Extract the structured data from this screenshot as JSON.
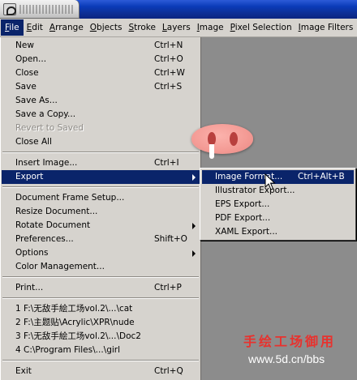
{
  "colors": {
    "menu_bg": "#d6d3ce",
    "highlight": "#0a246a",
    "workspace": "#8c8c8c",
    "titlebar": "#0a3bb8",
    "watermark_red": "#e8322e"
  },
  "menubar": {
    "items": [
      {
        "key": "F",
        "rest": "ile"
      },
      {
        "key": "E",
        "rest": "dit"
      },
      {
        "key": "A",
        "rest": "rrange"
      },
      {
        "key": "O",
        "rest": "bjects"
      },
      {
        "key": "S",
        "rest": "troke"
      },
      {
        "key": "L",
        "rest": "ayers"
      },
      {
        "key": "I",
        "rest": "mage"
      },
      {
        "key": "P",
        "rest": "ixel Selection"
      },
      {
        "key": "I",
        "rest": "mage Filters"
      }
    ]
  },
  "file_menu": {
    "new": {
      "label": "New",
      "shortcut": "Ctrl+N"
    },
    "open": {
      "label": "Open...",
      "shortcut": "Ctrl+O"
    },
    "close": {
      "label": "Close",
      "shortcut": "Ctrl+W"
    },
    "save": {
      "label": "Save",
      "shortcut": "Ctrl+S"
    },
    "save_as": {
      "label": "Save As..."
    },
    "save_copy": {
      "label": "Save a Copy..."
    },
    "revert": {
      "label": "Revert to Saved"
    },
    "close_all": {
      "label": "Close All"
    },
    "insert_image": {
      "label": "Insert Image...",
      "shortcut": "Ctrl+I"
    },
    "export": {
      "label": "Export"
    },
    "frame_setup": {
      "label": "Document Frame Setup..."
    },
    "resize": {
      "label": "Resize Document..."
    },
    "rotate": {
      "label": "Rotate Document"
    },
    "preferences": {
      "label": "Preferences...",
      "shortcut": "Shift+O"
    },
    "options": {
      "label": "Options"
    },
    "color_mgmt": {
      "label": "Color Management..."
    },
    "print": {
      "label": "Print...",
      "shortcut": "Ctrl+P"
    },
    "recent": [
      "1 F:\\无敌手絵工场vol.2\\...\\cat",
      "2 F:\\主题贴\\Acrylic\\XPR\\nude",
      "3 F:\\无敌手絵工场vol.2\\...\\Doc2",
      "4 C:\\Program Files\\...\\girl"
    ],
    "exit": {
      "label": "Exit",
      "shortcut": "Ctrl+Q"
    }
  },
  "export_menu": {
    "image_format": {
      "label": "Image Format...",
      "shortcut": "Ctrl+Alt+B"
    },
    "illustrator": {
      "label": "Illustrator Export..."
    },
    "eps": {
      "label": "EPS Export..."
    },
    "pdf": {
      "label": "PDF Export..."
    },
    "xaml": {
      "label": "XAML Export..."
    }
  },
  "watermark": {
    "title": "手绘工场御用",
    "url": "www.5d.cn/bbs"
  }
}
